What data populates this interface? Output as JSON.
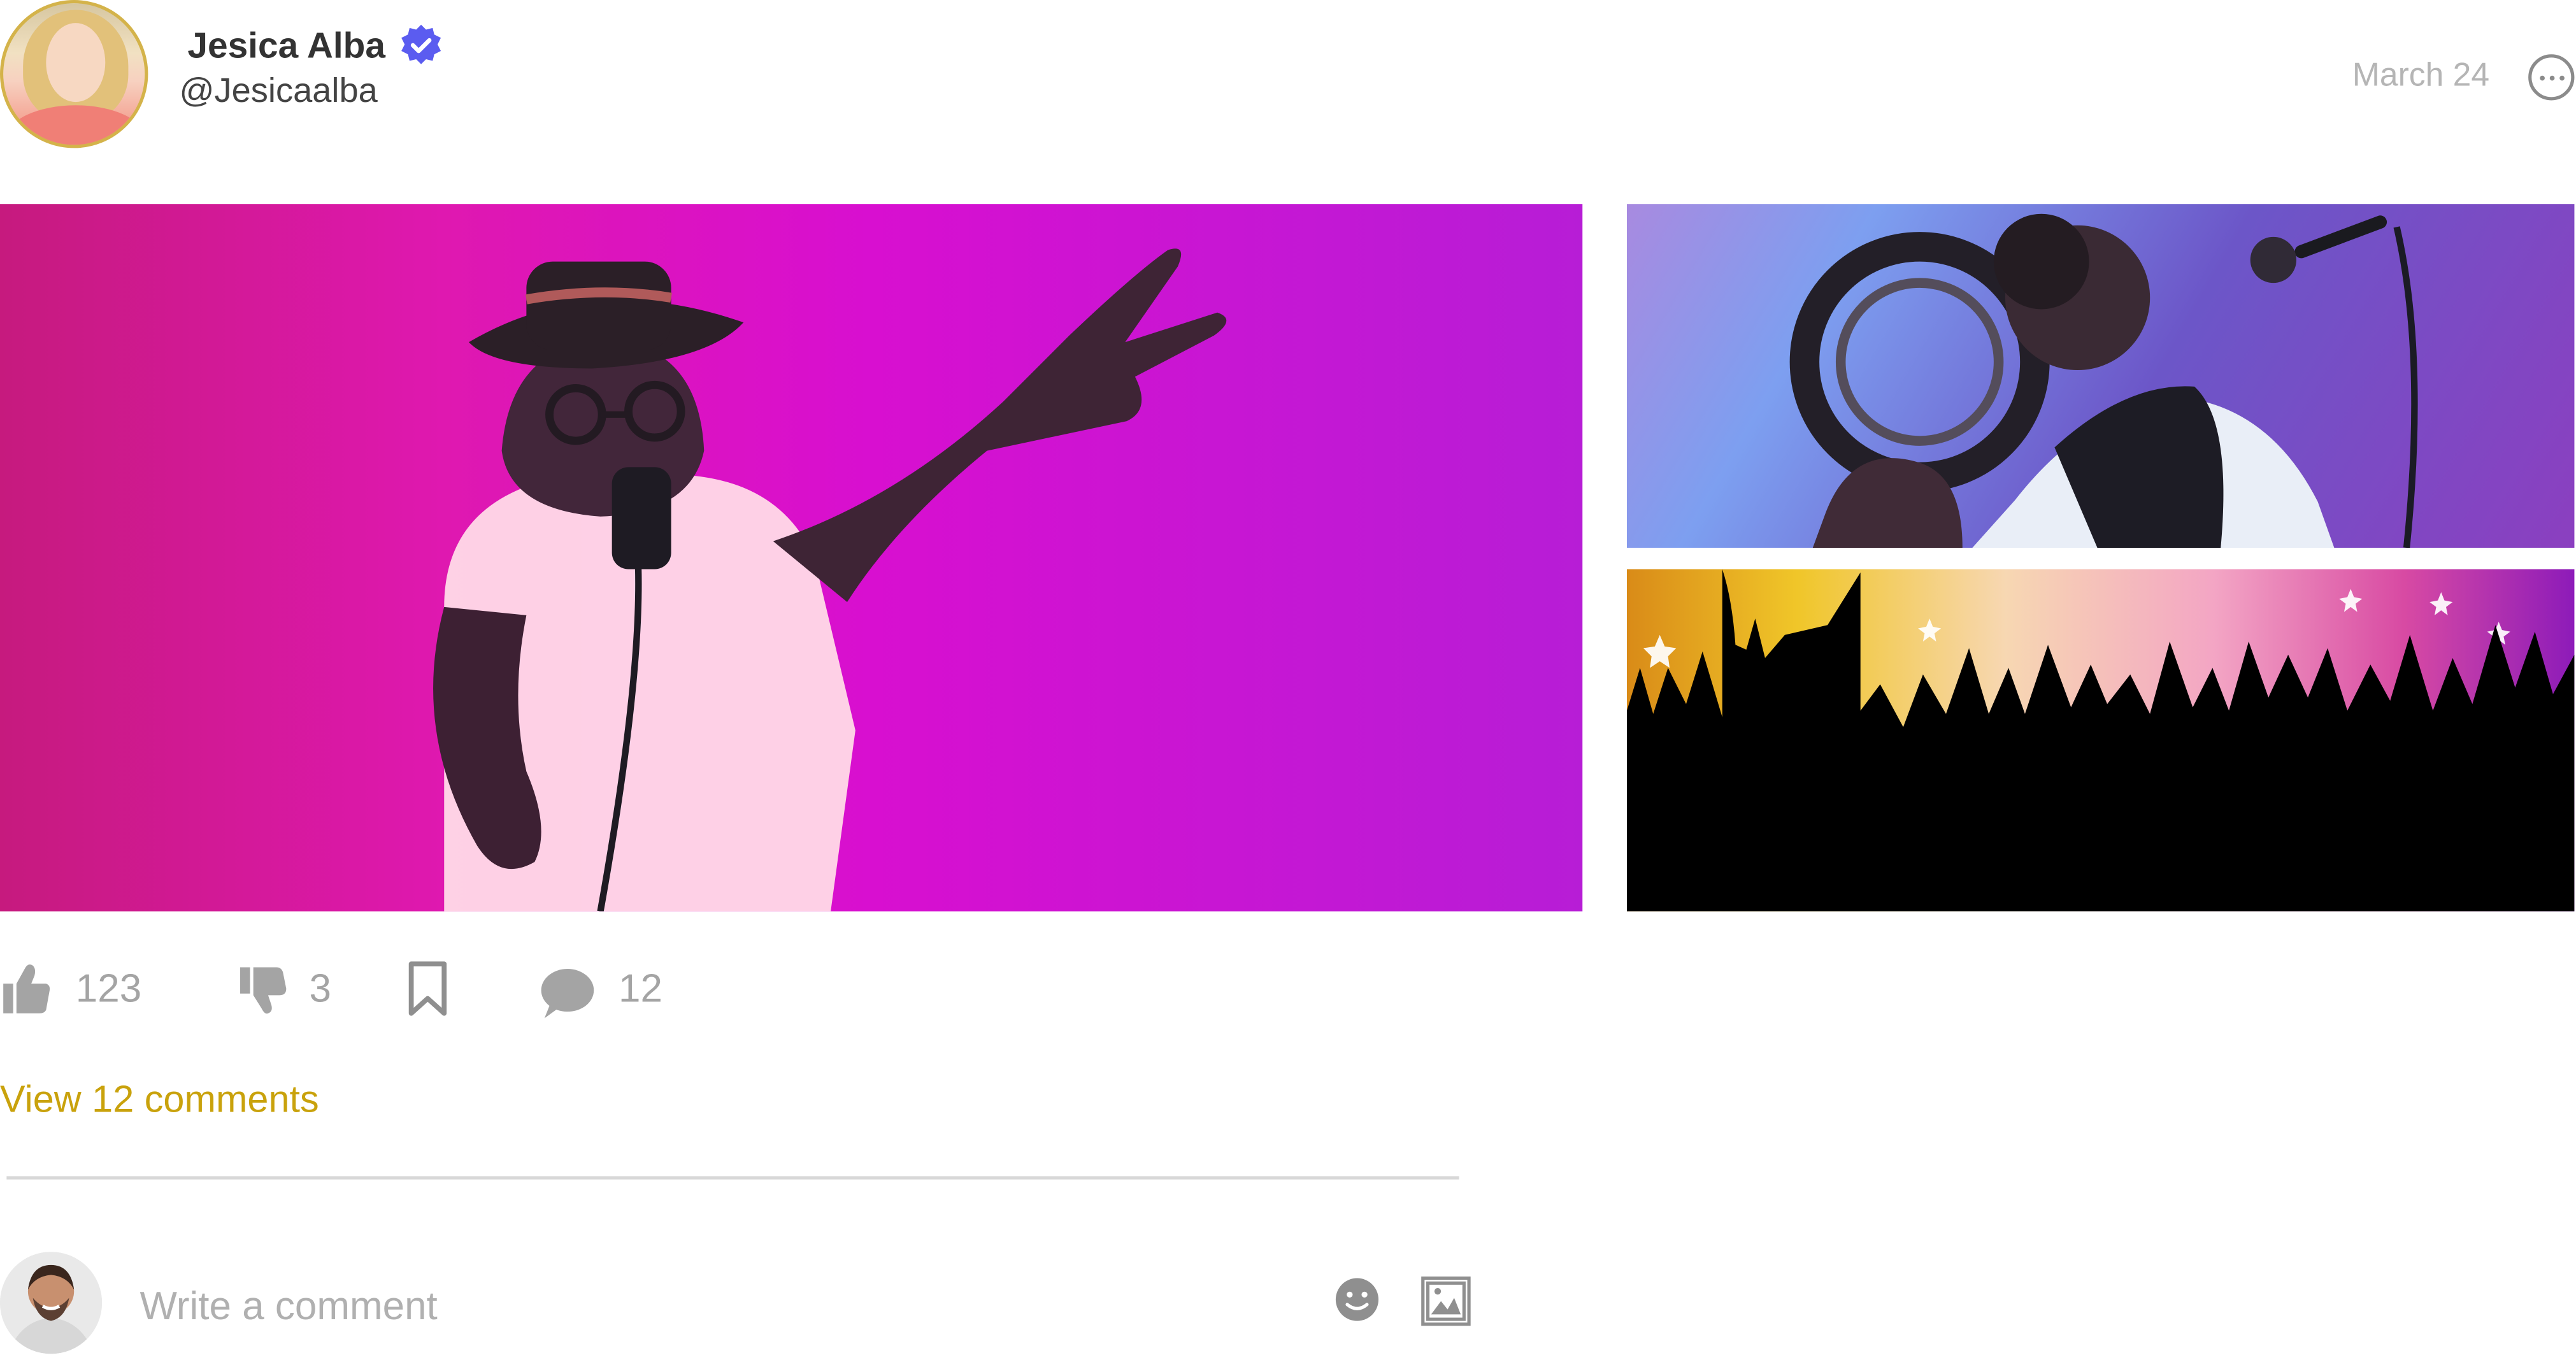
{
  "post": {
    "author_name": "Jesica Alba",
    "author_handle": "@Jesicaalba",
    "date": "March 24",
    "verified_icon": "verified-badge-icon",
    "more_icon": "more-options-icon",
    "stats": {
      "likes": "123",
      "dislikes": "3",
      "comments": "12"
    },
    "view_comments_text": "View 12 comments",
    "comment_placeholder": "Write a comment",
    "accent_color": "#c9a20c",
    "verified_color": "#5b5cf0"
  }
}
